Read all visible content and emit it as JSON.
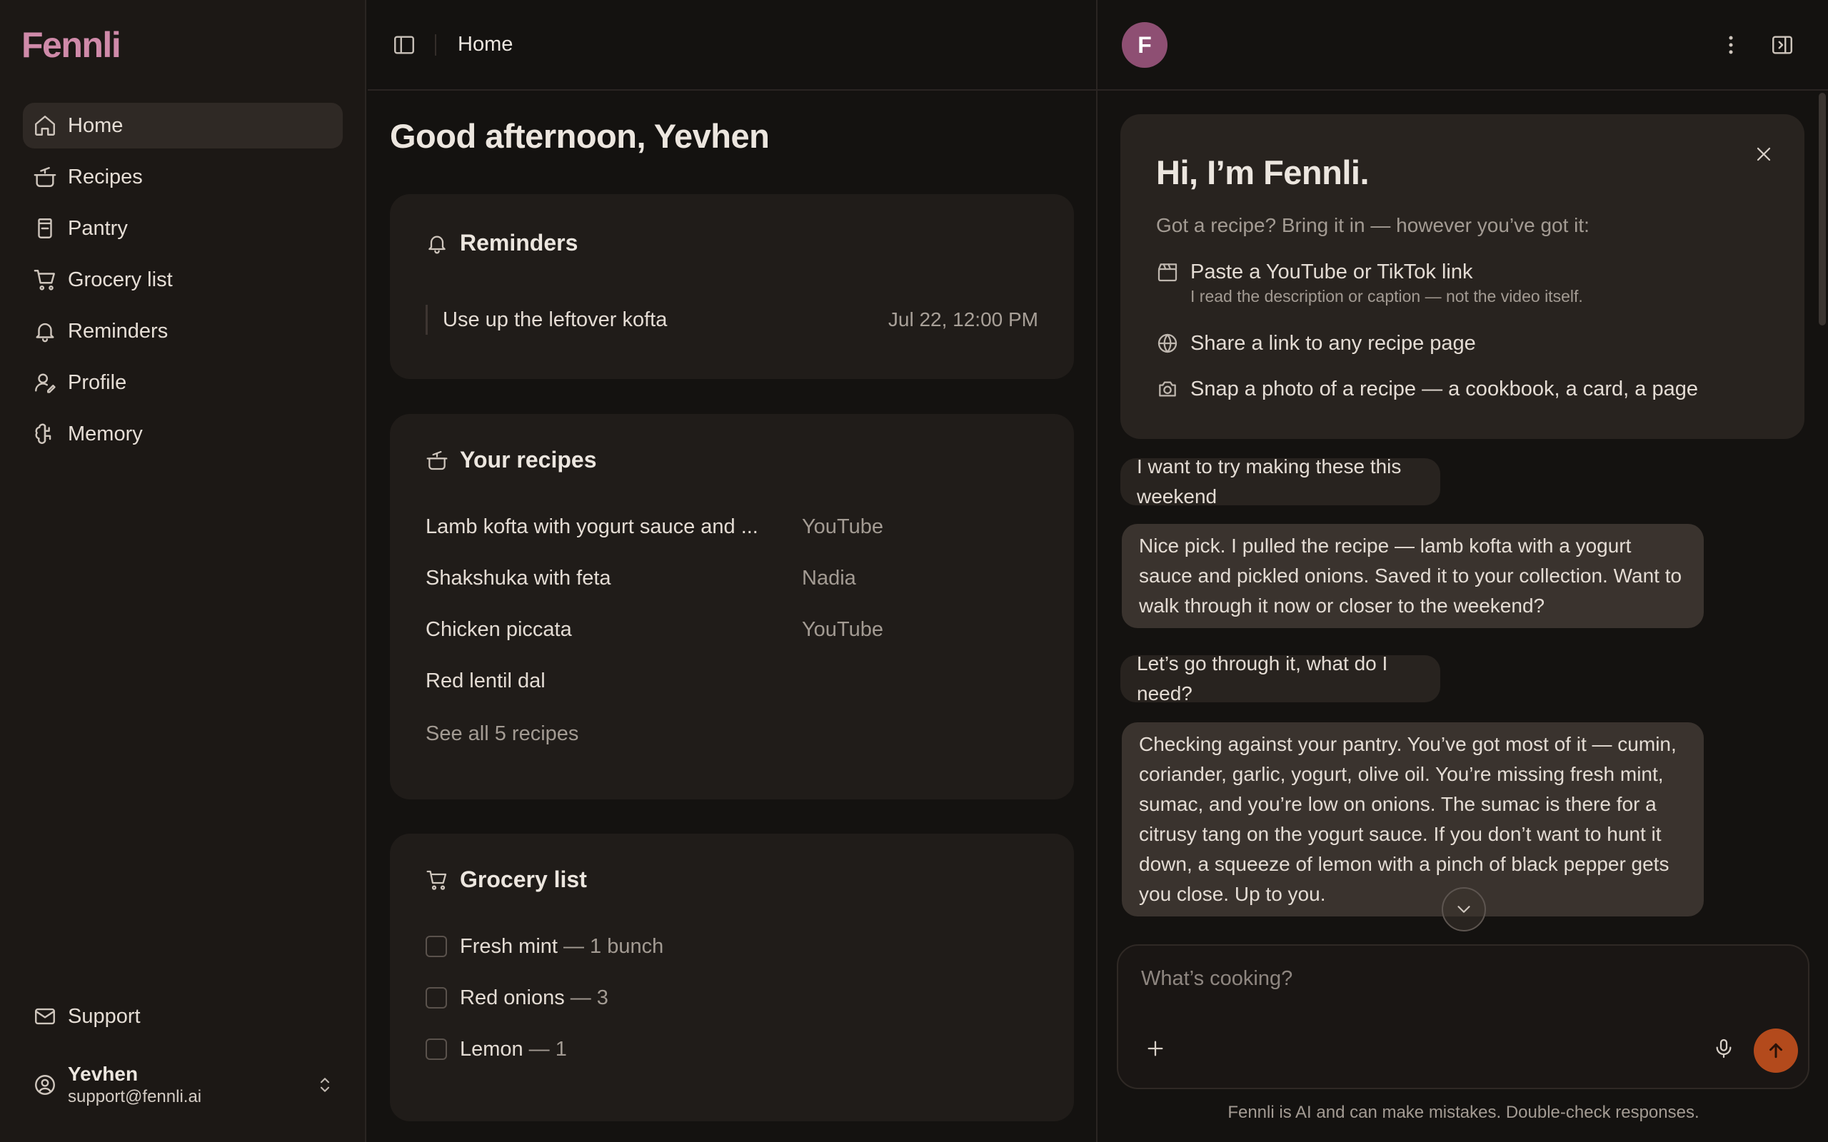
{
  "app": {
    "name": "Fennli",
    "brand_color": "#cf8aa9",
    "accent_color": "#b34a1c"
  },
  "sidebar": {
    "items": [
      {
        "label": "Home",
        "icon": "home-icon",
        "active": true
      },
      {
        "label": "Recipes",
        "icon": "pot-icon"
      },
      {
        "label": "Pantry",
        "icon": "jar-icon"
      },
      {
        "label": "Grocery list",
        "icon": "cart-icon"
      },
      {
        "label": "Reminders",
        "icon": "bell-icon"
      },
      {
        "label": "Profile",
        "icon": "user-edit-icon"
      },
      {
        "label": "Memory",
        "icon": "brain-icon"
      }
    ],
    "support": {
      "label": "Support",
      "icon": "mail-icon"
    },
    "user": {
      "name": "Yevhen",
      "email": "support@fennli.ai"
    }
  },
  "header": {
    "breadcrumb": "Home"
  },
  "main": {
    "greeting": "Good afternoon, Yevhen",
    "reminders": {
      "title": "Reminders",
      "items": [
        {
          "text": "Use up the leftover kofta",
          "date": "Jul 22, 12:00 PM"
        }
      ]
    },
    "recipes": {
      "title": "Your recipes",
      "items": [
        {
          "name": "Lamb kofta with yogurt sauce and ...",
          "source": "YouTube"
        },
        {
          "name": "Shakshuka with feta",
          "source": "Nadia"
        },
        {
          "name": "Chicken piccata",
          "source": "YouTube"
        },
        {
          "name": "Red lentil dal",
          "source": ""
        }
      ],
      "see_all": "See all 5 recipes"
    },
    "grocery": {
      "title": "Grocery list",
      "items": [
        {
          "name": "Fresh mint",
          "qty": "— 1 bunch",
          "checked": false
        },
        {
          "name": "Red onions",
          "qty": "— 3",
          "checked": false
        },
        {
          "name": "Lemon",
          "qty": "— 1",
          "checked": false
        }
      ]
    }
  },
  "chat": {
    "avatar_letter": "F",
    "welcome": {
      "title": "Hi, I’m Fennli.",
      "lead": "Got a recipe? Bring it in — however you’ve got it:",
      "options": [
        {
          "icon": "clapperboard-icon",
          "text": "Paste a YouTube or TikTok link",
          "detail": "I read the description or caption — not the video itself."
        },
        {
          "icon": "globe-icon",
          "text": "Share a link to any recipe page",
          "detail": ""
        },
        {
          "icon": "camera-icon",
          "text": "Snap a photo of a recipe — a cookbook, a card, a page",
          "detail": ""
        }
      ]
    },
    "messages": [
      {
        "role": "user",
        "text": "I want to try making these this weekend"
      },
      {
        "role": "assistant",
        "text": "Nice pick. I pulled the recipe — lamb kofta with a yogurt sauce and pickled onions. Saved it to your collection. Want to walk through it now or closer to the weekend?"
      },
      {
        "role": "user",
        "text": "Let’s go through it, what do I need?"
      },
      {
        "role": "assistant",
        "text": "Checking against your pantry. You’ve got most of it — cumin, coriander, garlic, yogurt, olive oil. You’re missing fresh mint, sumac, and you’re low on onions. The sumac is there for a citrusy tang on the yogurt sauce. If you don’t want to hunt it down, a squeeze of lemon with a pinch of black pepper gets you close. Up to you."
      }
    ],
    "composer": {
      "placeholder": "What’s cooking?"
    },
    "disclaimer": "Fennli is AI and can make mistakes. Double-check responses."
  }
}
